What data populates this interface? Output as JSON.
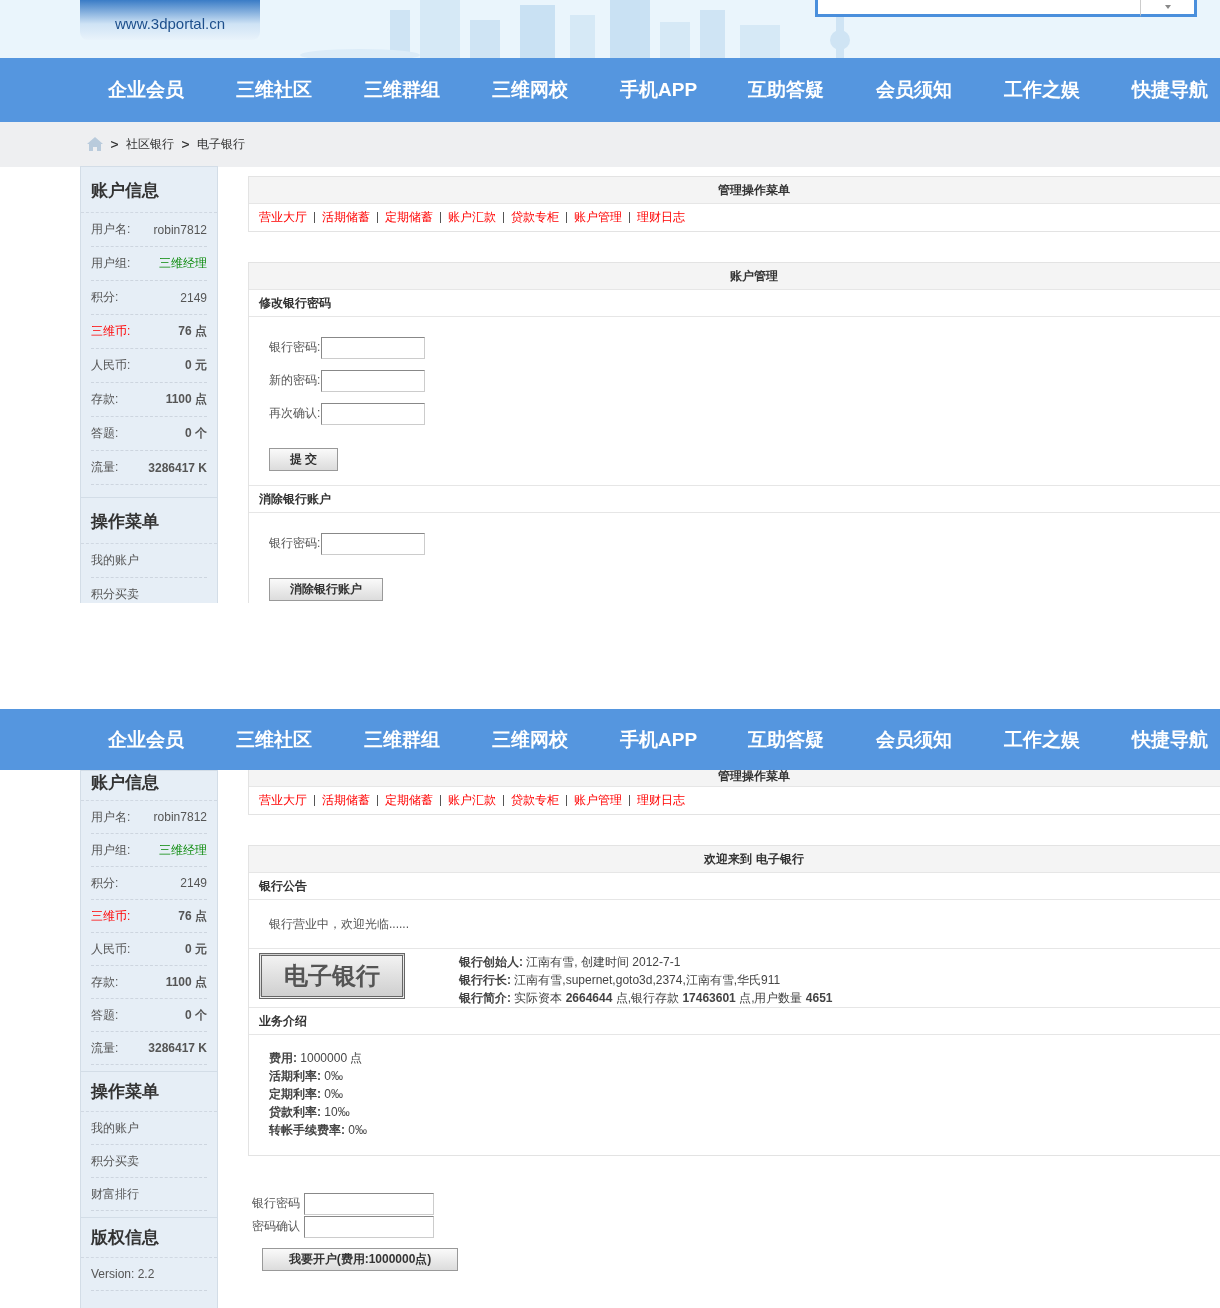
{
  "screens": [
    {
      "header": {
        "logo": "www.3dportal.cn"
      },
      "nav": [
        "企业会员",
        "三维社区",
        "三维群组",
        "三维网校",
        "手机APP",
        "互助答疑",
        "会员须知",
        "工作之娱",
        "快捷导航"
      ],
      "breadcrumb": [
        "社区银行",
        "电子银行"
      ],
      "sidebar": {
        "account_title": "账户信息",
        "rows": [
          {
            "label": "用户名:",
            "value": "robin7812",
            "kind": "plain"
          },
          {
            "label": "用户组:",
            "value": "三维经理",
            "kind": "group"
          },
          {
            "label": "积分:",
            "value": "2149",
            "kind": "plain"
          },
          {
            "label": "三维币:",
            "value": "76 点",
            "kind": "coin"
          },
          {
            "label": "人民币:",
            "value": "0 元",
            "kind": "bold"
          },
          {
            "label": "存款:",
            "value": "1100 点",
            "kind": "bold"
          },
          {
            "label": "答题:",
            "value": "0 个",
            "kind": "bold"
          },
          {
            "label": "流量:",
            "value": "3286417 K",
            "kind": "bold"
          }
        ],
        "menu_title": "操作菜单",
        "menu_items": [
          "我的账户",
          "积分买卖"
        ]
      },
      "menu_panel": {
        "title": "管理操作菜单",
        "links": [
          "营业大厅",
          "活期储蓄",
          "定期储蓄",
          "账户汇款",
          "贷款专柜",
          "账户管理",
          "理财日志"
        ]
      },
      "management_panel": {
        "title": "账户管理",
        "sections": [
          {
            "title": "修改银行密码",
            "fields": [
              "银行密码:",
              "新的密码:",
              "再次确认:"
            ],
            "button": "提 交"
          },
          {
            "title": "消除银行账户",
            "fields": [
              "银行密码:"
            ],
            "button": "消除银行账户"
          }
        ]
      }
    },
    {
      "nav": [
        "企业会员",
        "三维社区",
        "三维群组",
        "三维网校",
        "手机APP",
        "互助答疑",
        "会员须知",
        "工作之娱",
        "快捷导航"
      ],
      "sidebar": {
        "account_title": "账户信息",
        "rows": [
          {
            "label": "用户名:",
            "value": "robin7812",
            "kind": "plain"
          },
          {
            "label": "用户组:",
            "value": "三维经理",
            "kind": "group"
          },
          {
            "label": "积分:",
            "value": "2149",
            "kind": "plain"
          },
          {
            "label": "三维币:",
            "value": "76 点",
            "kind": "coin"
          },
          {
            "label": "人民币:",
            "value": "0 元",
            "kind": "bold"
          },
          {
            "label": "存款:",
            "value": "1100 点",
            "kind": "bold"
          },
          {
            "label": "答题:",
            "value": "0 个",
            "kind": "bold"
          },
          {
            "label": "流量:",
            "value": "3286417 K",
            "kind": "bold"
          }
        ],
        "menu_title": "操作菜单",
        "menu_items": [
          "我的账户",
          "积分买卖",
          "财富排行"
        ],
        "copyright_title": "版权信息",
        "version": "Version: 2.2"
      },
      "menu_panel": {
        "title": "管理操作菜单",
        "links": [
          "营业大厅",
          "活期储蓄",
          "定期储蓄",
          "账户汇款",
          "贷款专柜",
          "账户管理",
          "理财日志"
        ]
      },
      "welcome_panel": {
        "title": "欢迎来到 电子银行",
        "notice_title": "银行公告",
        "notice": "银行营业中，欢迎光临......",
        "bank_logo": "电子银行",
        "info": [
          "**银行创始人:** 江南有雪, 创建时间 2012-7-1",
          "**银行行长:** 江南有雪,supernet,goto3d,2374,江南有雪,华氏911",
          "**银行简介:** 实际资本 **2664644** 点,银行存款 **17463601** 点,用户数量 **4651**"
        ],
        "business_title": "业务介绍",
        "business": [
          "**费用:** 1000000 点",
          "**活期利率:** 0‰",
          "**定期利率:** 0‰",
          "**贷款利率:** 10‰",
          "**转帐手续费率:** 0‰"
        ]
      },
      "open_account_form": {
        "fields": [
          "银行密码",
          "密码确认"
        ],
        "button": "我要开户(费用:1000000点)"
      }
    }
  ]
}
